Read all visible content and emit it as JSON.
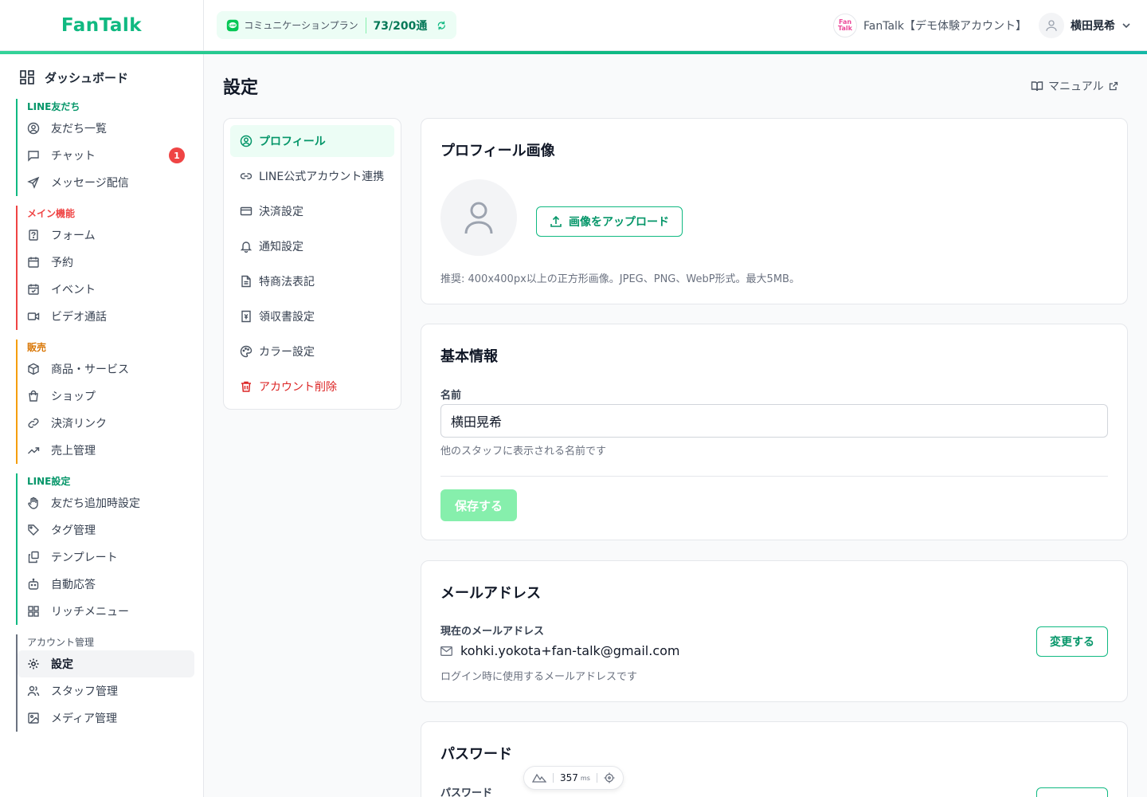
{
  "header": {
    "brand": "FanTalk",
    "plan_label": "コミュニケーションプラン",
    "plan_count": "73/200通",
    "account_logo_text": "Fan Talk",
    "account_name": "FanTalk【デモ体験アカウント】",
    "user_name": "横田晃希"
  },
  "sidebar": {
    "dashboard": "ダッシュボード",
    "groups": [
      {
        "title": "LINE友だち",
        "color": "#10b981",
        "items": [
          "友だち一覧",
          "チャット",
          "メッセージ配信"
        ]
      },
      {
        "title": "メイン機能",
        "color": "#ef4444",
        "items": [
          "フォーム",
          "予約",
          "イベント",
          "ビデオ通話"
        ]
      },
      {
        "title": "販売",
        "color": "#f59e0b",
        "items": [
          "商品・サービス",
          "ショップ",
          "決済リンク",
          "売上管理"
        ]
      },
      {
        "title": "LINE設定",
        "color": "#10b981",
        "items": [
          "友だち追加時設定",
          "タグ管理",
          "テンプレート",
          "自動応答",
          "リッチメニュー"
        ]
      },
      {
        "title": "アカウント管理",
        "color": "#6b7280",
        "items": [
          "設定",
          "スタッフ管理",
          "メディア管理"
        ]
      }
    ],
    "chat_badge": "1"
  },
  "main": {
    "title": "設定",
    "manual": "マニュアル"
  },
  "settings_nav": [
    "プロフィール",
    "LINE公式アカウント連携",
    "決済設定",
    "通知設定",
    "特商法表記",
    "領収書設定",
    "カラー設定",
    "アカウント削除"
  ],
  "profile_image": {
    "title": "プロフィール画像",
    "upload_button": "画像をアップロード",
    "hint": "推奨: 400x400px以上の正方形画像。JPEG、PNG、WebP形式。最大5MB。"
  },
  "basic_info": {
    "title": "基本情報",
    "name_label": "名前",
    "name_value": "横田晃希",
    "name_hint": "他のスタッフに表示される名前です",
    "save_button": "保存する"
  },
  "email": {
    "title": "メールアドレス",
    "current_label": "現在のメールアドレス",
    "address": "kohki.yokota+fan-talk@gmail.com",
    "hint": "ログイン時に使用するメールアドレスです",
    "change_button": "変更する"
  },
  "password": {
    "title": "パスワード",
    "label": "パスワード"
  },
  "perf": {
    "value": "357",
    "unit": "ms"
  },
  "colors": {
    "accent": "#10b981",
    "danger": "#ef4444",
    "warning": "#f59e0b"
  }
}
